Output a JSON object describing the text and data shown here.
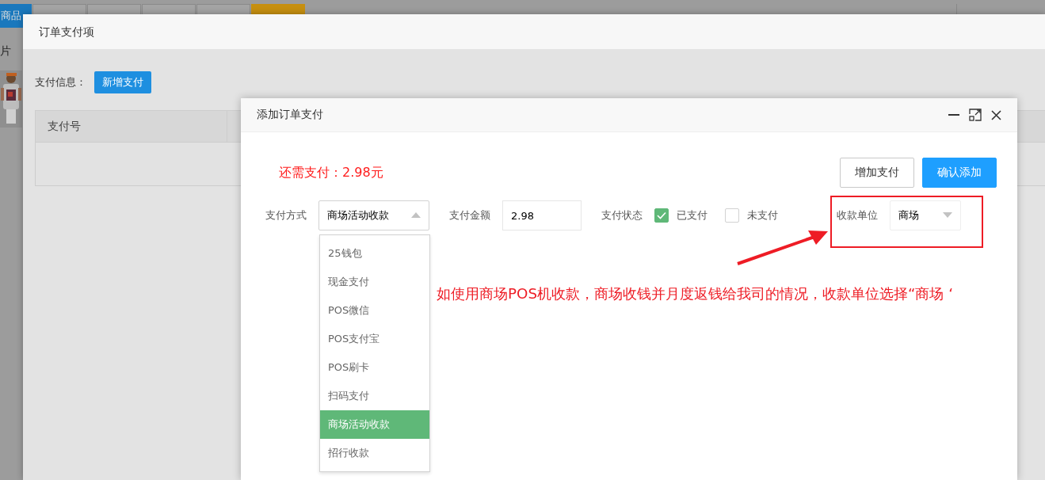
{
  "background": {
    "toolbar_buttons": [
      {
        "label": "商品",
        "kind": "primary"
      },
      {
        "kind": "default"
      },
      {
        "kind": "default"
      },
      {
        "kind": "default"
      },
      {
        "kind": "default"
      },
      {
        "kind": "warning"
      }
    ],
    "side_text": "片"
  },
  "order_dialog": {
    "title": "订单支付项",
    "payment_info_label": "支付信息：",
    "add_payment_button": "新增支付",
    "table": {
      "columns": [
        "支付号"
      ]
    }
  },
  "add_dialog": {
    "title": "添加订单支付",
    "remaining": "还需支付：2.98元",
    "buttons": [
      {
        "label": "增加支付",
        "kind": "default"
      },
      {
        "label": "确认添加",
        "kind": "primary"
      }
    ],
    "payment_method": {
      "label": "支付方式",
      "value": "商场活动收款",
      "expanded": true,
      "options": [
        {
          "label": "25钱包",
          "selected": false
        },
        {
          "label": "现金支付",
          "selected": false
        },
        {
          "label": "POS微信",
          "selected": false
        },
        {
          "label": "POS支付宝",
          "selected": false
        },
        {
          "label": "POS刷卡",
          "selected": false
        },
        {
          "label": "扫码支付",
          "selected": false
        },
        {
          "label": "商场活动收款",
          "selected": true
        },
        {
          "label": "招行收款",
          "selected": false
        }
      ]
    },
    "amount": {
      "label": "支付金额",
      "value": "2.98"
    },
    "status": {
      "label": "支付状态",
      "options": [
        {
          "label": "已支付",
          "checked": true
        },
        {
          "label": "未支付",
          "checked": false
        }
      ]
    },
    "payee": {
      "label": "收款单位",
      "value": "商场"
    }
  },
  "annotation": {
    "text": "如使用商场POS机收款，商场收钱并月度返钱给我司的情况，收款单位选择“商场 ‘"
  }
}
